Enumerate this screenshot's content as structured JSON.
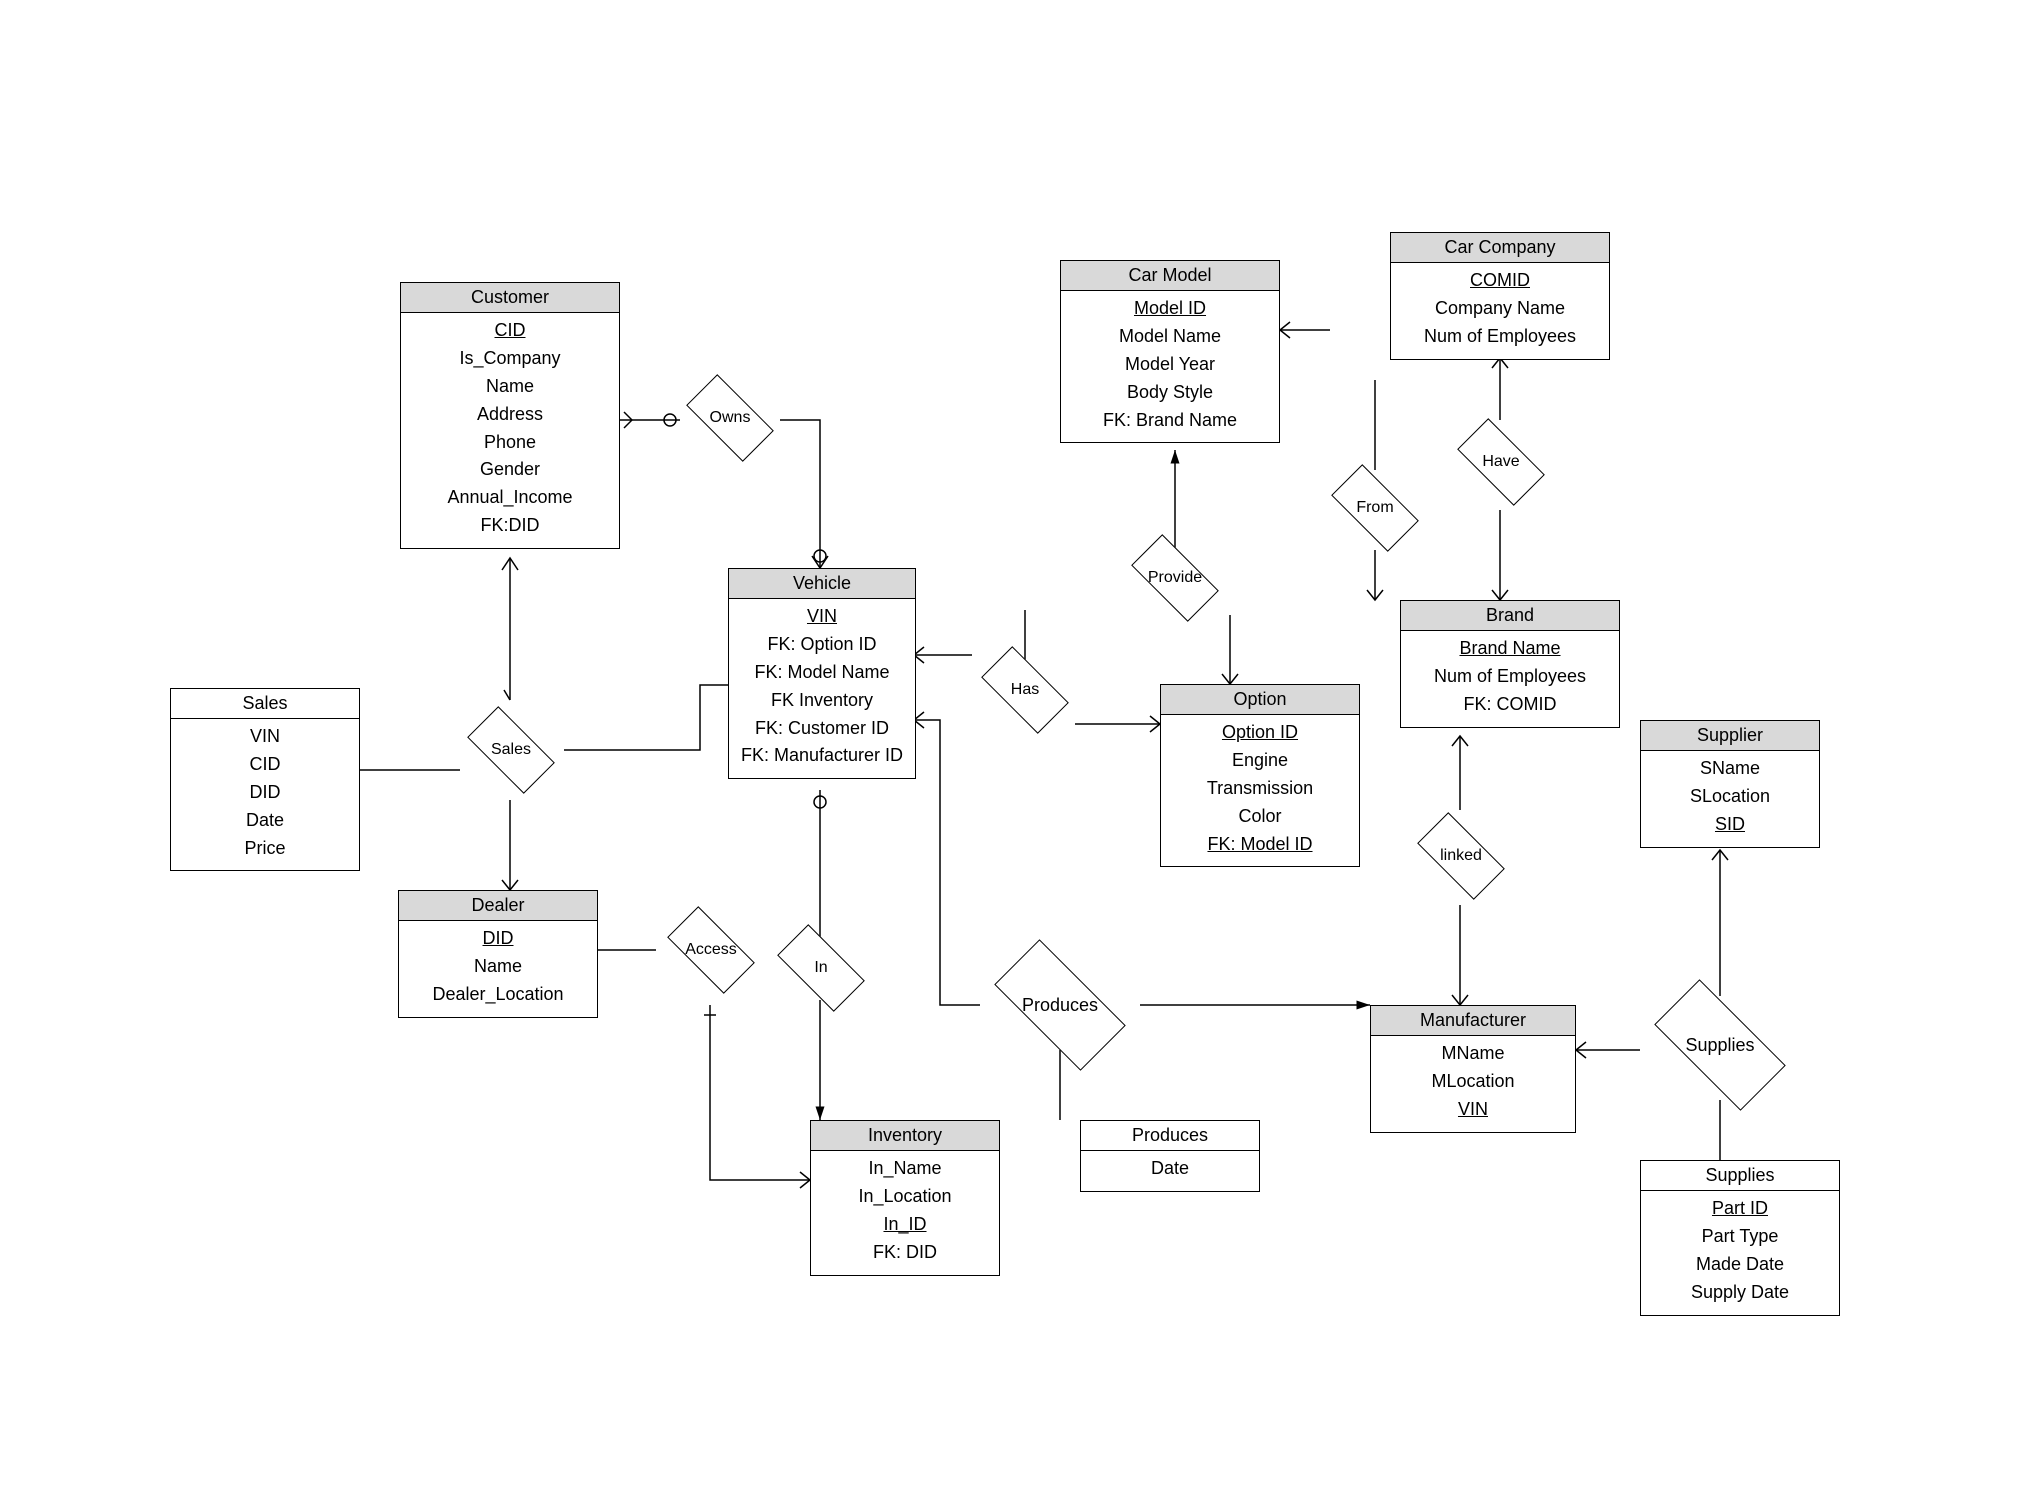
{
  "entities": {
    "customer": {
      "title": "Customer",
      "attrs": [
        {
          "text": "CID",
          "u": true
        },
        {
          "text": "Is_Company"
        },
        {
          "text": "Name"
        },
        {
          "text": "Address"
        },
        {
          "text": "Phone"
        },
        {
          "text": "Gender"
        },
        {
          "text": "Annual_Income"
        },
        {
          "text": "FK:DID"
        }
      ]
    },
    "vehicle": {
      "title": "Vehicle",
      "attrs": [
        {
          "text": "VIN",
          "u": true
        },
        {
          "text": "FK: Option ID"
        },
        {
          "text": "FK: Model Name"
        },
        {
          "text": "FK Inventory"
        },
        {
          "text": "FK: Customer ID"
        },
        {
          "text": "FK: Manufacturer ID"
        }
      ]
    },
    "car_model": {
      "title": "Car Model",
      "attrs": [
        {
          "text": "Model ID",
          "u": true
        },
        {
          "text": "Model Name"
        },
        {
          "text": "Model Year"
        },
        {
          "text": "Body Style"
        },
        {
          "text": "FK: Brand Name"
        }
      ]
    },
    "car_company": {
      "title": "Car Company",
      "attrs": [
        {
          "text": "COMID",
          "u": true
        },
        {
          "text": "Company Name"
        },
        {
          "text": "Num of Employees"
        }
      ]
    },
    "option": {
      "title": "Option",
      "attrs": [
        {
          "text": "Option ID",
          "u": true
        },
        {
          "text": "Engine"
        },
        {
          "text": "Transmission"
        },
        {
          "text": "Color"
        },
        {
          "text": "FK: Model ID",
          "u": true
        }
      ]
    },
    "brand": {
      "title": "Brand",
      "attrs": [
        {
          "text": "Brand Name",
          "u": true
        },
        {
          "text": "Num of Employees"
        },
        {
          "text": "FK: COMID"
        }
      ]
    },
    "dealer": {
      "title": "Dealer",
      "attrs": [
        {
          "text": "DID",
          "u": true
        },
        {
          "text": "Name"
        },
        {
          "text": "Dealer_Location"
        }
      ]
    },
    "supplier": {
      "title": "Supplier",
      "attrs": [
        {
          "text": "SName"
        },
        {
          "text": "SLocation"
        },
        {
          "text": "SID",
          "u": true
        }
      ]
    },
    "manufacturer": {
      "title": "Manufacturer",
      "attrs": [
        {
          "text": "MName"
        },
        {
          "text": "MLocation"
        },
        {
          "text": "VIN",
          "u": true
        }
      ]
    },
    "inventory": {
      "title": "Inventory",
      "attrs": [
        {
          "text": "In_Name"
        },
        {
          "text": "In_Location"
        },
        {
          "text": "In_ID",
          "u": true
        },
        {
          "text": "FK: DID"
        }
      ]
    }
  },
  "rel_tables": {
    "sales": {
      "title": "Sales",
      "attrs": [
        {
          "text": "VIN"
        },
        {
          "text": "CID"
        },
        {
          "text": "DID"
        },
        {
          "text": "Date"
        },
        {
          "text": "Price"
        }
      ]
    },
    "produces": {
      "title": "Produces",
      "attrs": [
        {
          "text": "Date"
        }
      ]
    },
    "supplies": {
      "title": "Supplies",
      "attrs": [
        {
          "text": "Part ID",
          "u": true
        },
        {
          "text": "Part Type"
        },
        {
          "text": "Made Date"
        },
        {
          "text": "Supply Date"
        }
      ]
    }
  },
  "relations": {
    "owns": "Owns",
    "sales": "Sales",
    "access": "Access",
    "in": "In",
    "has": "Has",
    "provide": "Provide",
    "produces": "Produces",
    "from": "From",
    "have": "Have",
    "linked": "linked",
    "supplies": "Supplies"
  }
}
